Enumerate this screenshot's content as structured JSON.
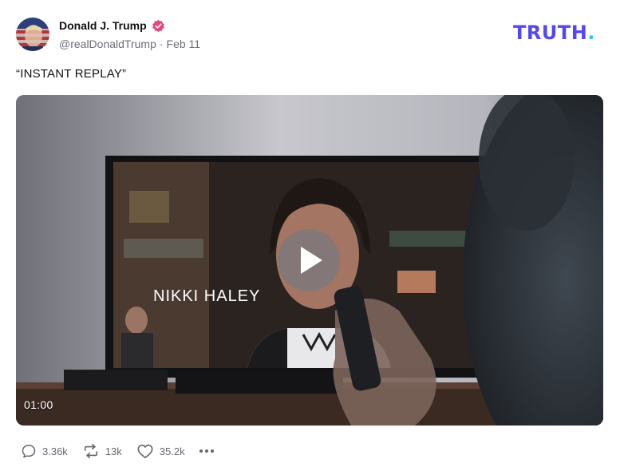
{
  "author": {
    "display_name": "Donald J. Trump",
    "handle": "@realDonaldTrump",
    "separator": "·",
    "date": "Feb 11",
    "verified": true,
    "verified_color": "#e2497a"
  },
  "brand": {
    "wordmark": "TRUTH",
    "dot": ".",
    "color": "#5448ee",
    "dot_color": "#2fd3bf"
  },
  "post": {
    "text": "“INSTANT REPLAY”"
  },
  "video": {
    "duration": "01:00",
    "lower_third": "NIKKI HALEY",
    "controls": {
      "play_icon": "play-icon"
    }
  },
  "actions": {
    "replies": {
      "icon": "reply-icon",
      "count": "3.36k"
    },
    "retruths": {
      "icon": "retruth-icon",
      "count": "13k"
    },
    "likes": {
      "icon": "heart-icon",
      "count": "35.2k"
    },
    "more": {
      "icon": "more-icon"
    }
  }
}
